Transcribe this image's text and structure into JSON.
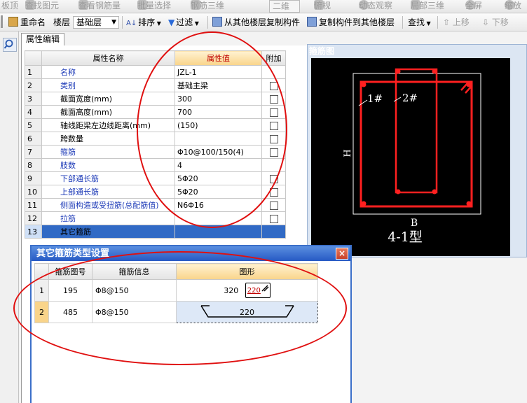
{
  "toolbar_top": {
    "items": [
      "板顶",
      "查找图元",
      "查看钢筋量",
      "批量选择",
      "钢筋三维",
      "二维",
      "俯视",
      "动态观察",
      "局部三维",
      "全屏",
      "缩放"
    ]
  },
  "toolbar_main": {
    "rename": "重命名",
    "floor_label": "楼层",
    "floor_value": "基础层",
    "sort": "排序",
    "filter": "过滤",
    "copy_from_floor": "从其他楼层复制构件",
    "copy_to_floor": "复制构件到其他楼层",
    "find": "查找",
    "move_up": "上移",
    "move_down": "下移"
  },
  "property_editor": {
    "tab_label": "属性编辑",
    "columns": [
      "属性名称",
      "属性值",
      "附加"
    ],
    "rows": [
      {
        "no": "1",
        "name": "名称",
        "value": "JZL-1",
        "check": false,
        "blue": true
      },
      {
        "no": "2",
        "name": "类别",
        "value": "基础主梁",
        "check": true,
        "blue": true
      },
      {
        "no": "3",
        "name": "截面宽度(mm)",
        "value": "300",
        "check": true,
        "blue": false
      },
      {
        "no": "4",
        "name": "截面高度(mm)",
        "value": "700",
        "check": true,
        "blue": false
      },
      {
        "no": "5",
        "name": "轴线距梁左边线距离(mm)",
        "value": "(150)",
        "check": true,
        "blue": false
      },
      {
        "no": "6",
        "name": "跨数量",
        "value": "",
        "check": true,
        "blue": false
      },
      {
        "no": "7",
        "name": "箍筋",
        "value": "Φ10@100/150(4)",
        "check": true,
        "blue": true
      },
      {
        "no": "8",
        "name": "肢数",
        "value": "4",
        "check": false,
        "blue": true
      },
      {
        "no": "9",
        "name": "下部通长筋",
        "value": "5Φ20",
        "check": true,
        "blue": true
      },
      {
        "no": "10",
        "name": "上部通长筋",
        "value": "5Φ20",
        "check": true,
        "blue": true
      },
      {
        "no": "11",
        "name": "侧面构造或受扭筋(总配筋值)",
        "value": "N6Φ16",
        "check": true,
        "blue": true
      },
      {
        "no": "12",
        "name": "拉筋",
        "value": "",
        "check": true,
        "blue": true
      },
      {
        "no": "13",
        "name": "其它箍筋",
        "value": "",
        "check": false,
        "blue": false
      }
    ]
  },
  "stirrup_panel": {
    "title": "箍筋图",
    "label_1": "1#",
    "label_2": "2#",
    "label_h": "H",
    "label_b": "B",
    "type_label": "4-1型",
    "colors": {
      "background": "#000000",
      "stirrup": "#ff2020",
      "outline": "#ffffff"
    }
  },
  "dialog": {
    "title": "其它箍筋类型设置",
    "close_label": "×",
    "columns": [
      "箍筋图号",
      "箍筋信息",
      "图形"
    ],
    "rows": [
      {
        "no": "1",
        "code": "195",
        "info": "Φ8@150",
        "shape_left": "320",
        "shape_right": "220"
      },
      {
        "no": "2",
        "code": "485",
        "info": "Φ8@150",
        "shape_center": "220"
      }
    ]
  },
  "colors": {
    "annotation_ellipse": "#e01010",
    "selection": "#316ac5",
    "dialog_title": "#2659c4"
  }
}
